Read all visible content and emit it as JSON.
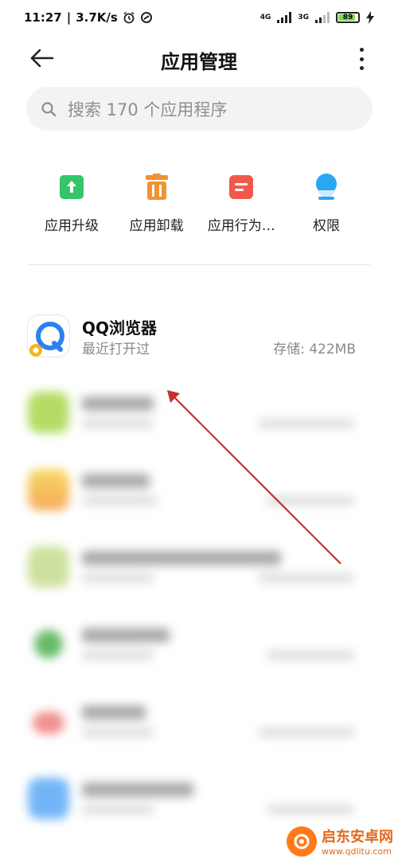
{
  "status_bar": {
    "time": "11:27",
    "speed": "3.7K/s",
    "net1": "4G",
    "net2": "3G",
    "battery": "89",
    "battery_color": "#7ed957"
  },
  "header": {
    "title": "应用管理",
    "back_icon": "arrow-left-icon",
    "more_icon": "more-vertical-icon"
  },
  "search": {
    "placeholder": "搜索 170 个应用程序",
    "icon": "search-icon"
  },
  "actions": [
    {
      "label": "应用升级",
      "icon": "upgrade-icon",
      "color": "#35c46a"
    },
    {
      "label": "应用卸载",
      "icon": "trash-icon",
      "color": "#f39232"
    },
    {
      "label": "应用行为…",
      "icon": "behavior-icon",
      "color": "#f0584a"
    },
    {
      "label": "权限",
      "icon": "permission-icon",
      "color": "#2ba6f0"
    }
  ],
  "apps": [
    {
      "name": "QQ浏览器",
      "sub": "最近打开过",
      "size": "存储: 422MB",
      "icon_color": "#ffffff"
    },
    {
      "name": "",
      "sub": "",
      "size": "",
      "icon_color": "#a8d64a"
    },
    {
      "name": "",
      "sub": "",
      "size": "",
      "icon_color": "#f3a23a"
    },
    {
      "name": "",
      "sub": "",
      "size": "",
      "icon_color": "#b9d67a"
    },
    {
      "name": "",
      "sub": "",
      "size": "",
      "icon_color": "#4caf50"
    },
    {
      "name": "",
      "sub": "",
      "size": "",
      "icon_color": "#f07d7d"
    },
    {
      "name": "",
      "sub": "",
      "size": "",
      "icon_color": "#5aa9f6"
    }
  ],
  "watermark": {
    "title": "启东安卓网",
    "url": "www.qdlitu.com",
    "color": "#e2691a"
  },
  "annotation": {
    "arrow_color": "#c0322e"
  }
}
